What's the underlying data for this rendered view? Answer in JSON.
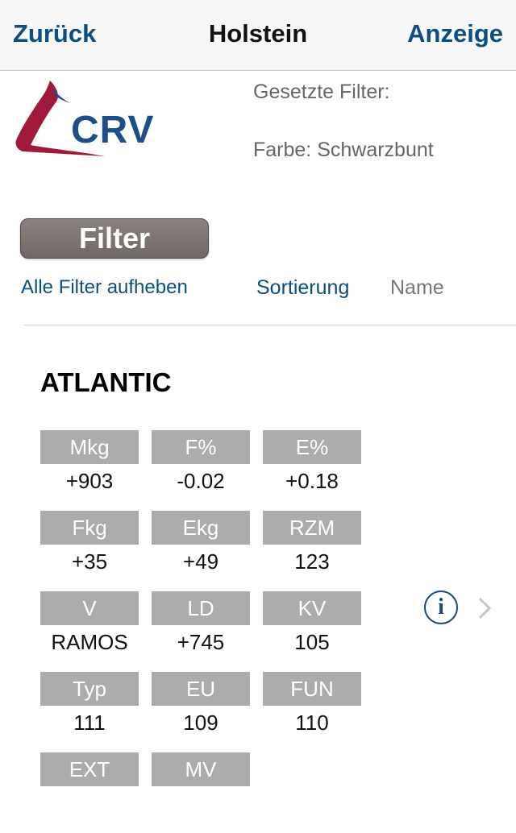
{
  "nav": {
    "back_label": "Zurück",
    "title": "Holstein",
    "action_label": "Anzeige"
  },
  "logo": {
    "text": "CRV"
  },
  "filters": {
    "heading": "Gesetzte Filter:",
    "color_filter": "Farbe: Schwarzbunt"
  },
  "controls": {
    "filter_button": "Filter",
    "clear_all": "Alle Filter aufheben",
    "sort_label": "Sortierung",
    "sort_value": "Name"
  },
  "bull": {
    "name": "ATLANTIC",
    "traits": [
      {
        "label": "Mkg",
        "value": "+903"
      },
      {
        "label": "F%",
        "value": "-0.02"
      },
      {
        "label": "E%",
        "value": "+0.18"
      },
      {
        "label": "Fkg",
        "value": "+35"
      },
      {
        "label": "Ekg",
        "value": "+49"
      },
      {
        "label": "RZM",
        "value": "123"
      },
      {
        "label": "V",
        "value": "RAMOS"
      },
      {
        "label": "LD",
        "value": "+745"
      },
      {
        "label": "KV",
        "value": "105"
      },
      {
        "label": "Typ",
        "value": "111"
      },
      {
        "label": "EU",
        "value": "109"
      },
      {
        "label": "FUN",
        "value": "110"
      },
      {
        "label": "EXT",
        "value": ""
      },
      {
        "label": "MV",
        "value": ""
      }
    ]
  },
  "icons": {
    "info": "info-icon",
    "chevron": "chevron-right-icon"
  },
  "colors": {
    "accent": "#0b4f80",
    "header_cell": "#acacac",
    "filter_button": "#7a7370",
    "logo_red": "#a0183a",
    "logo_blue": "#1c4f86"
  }
}
